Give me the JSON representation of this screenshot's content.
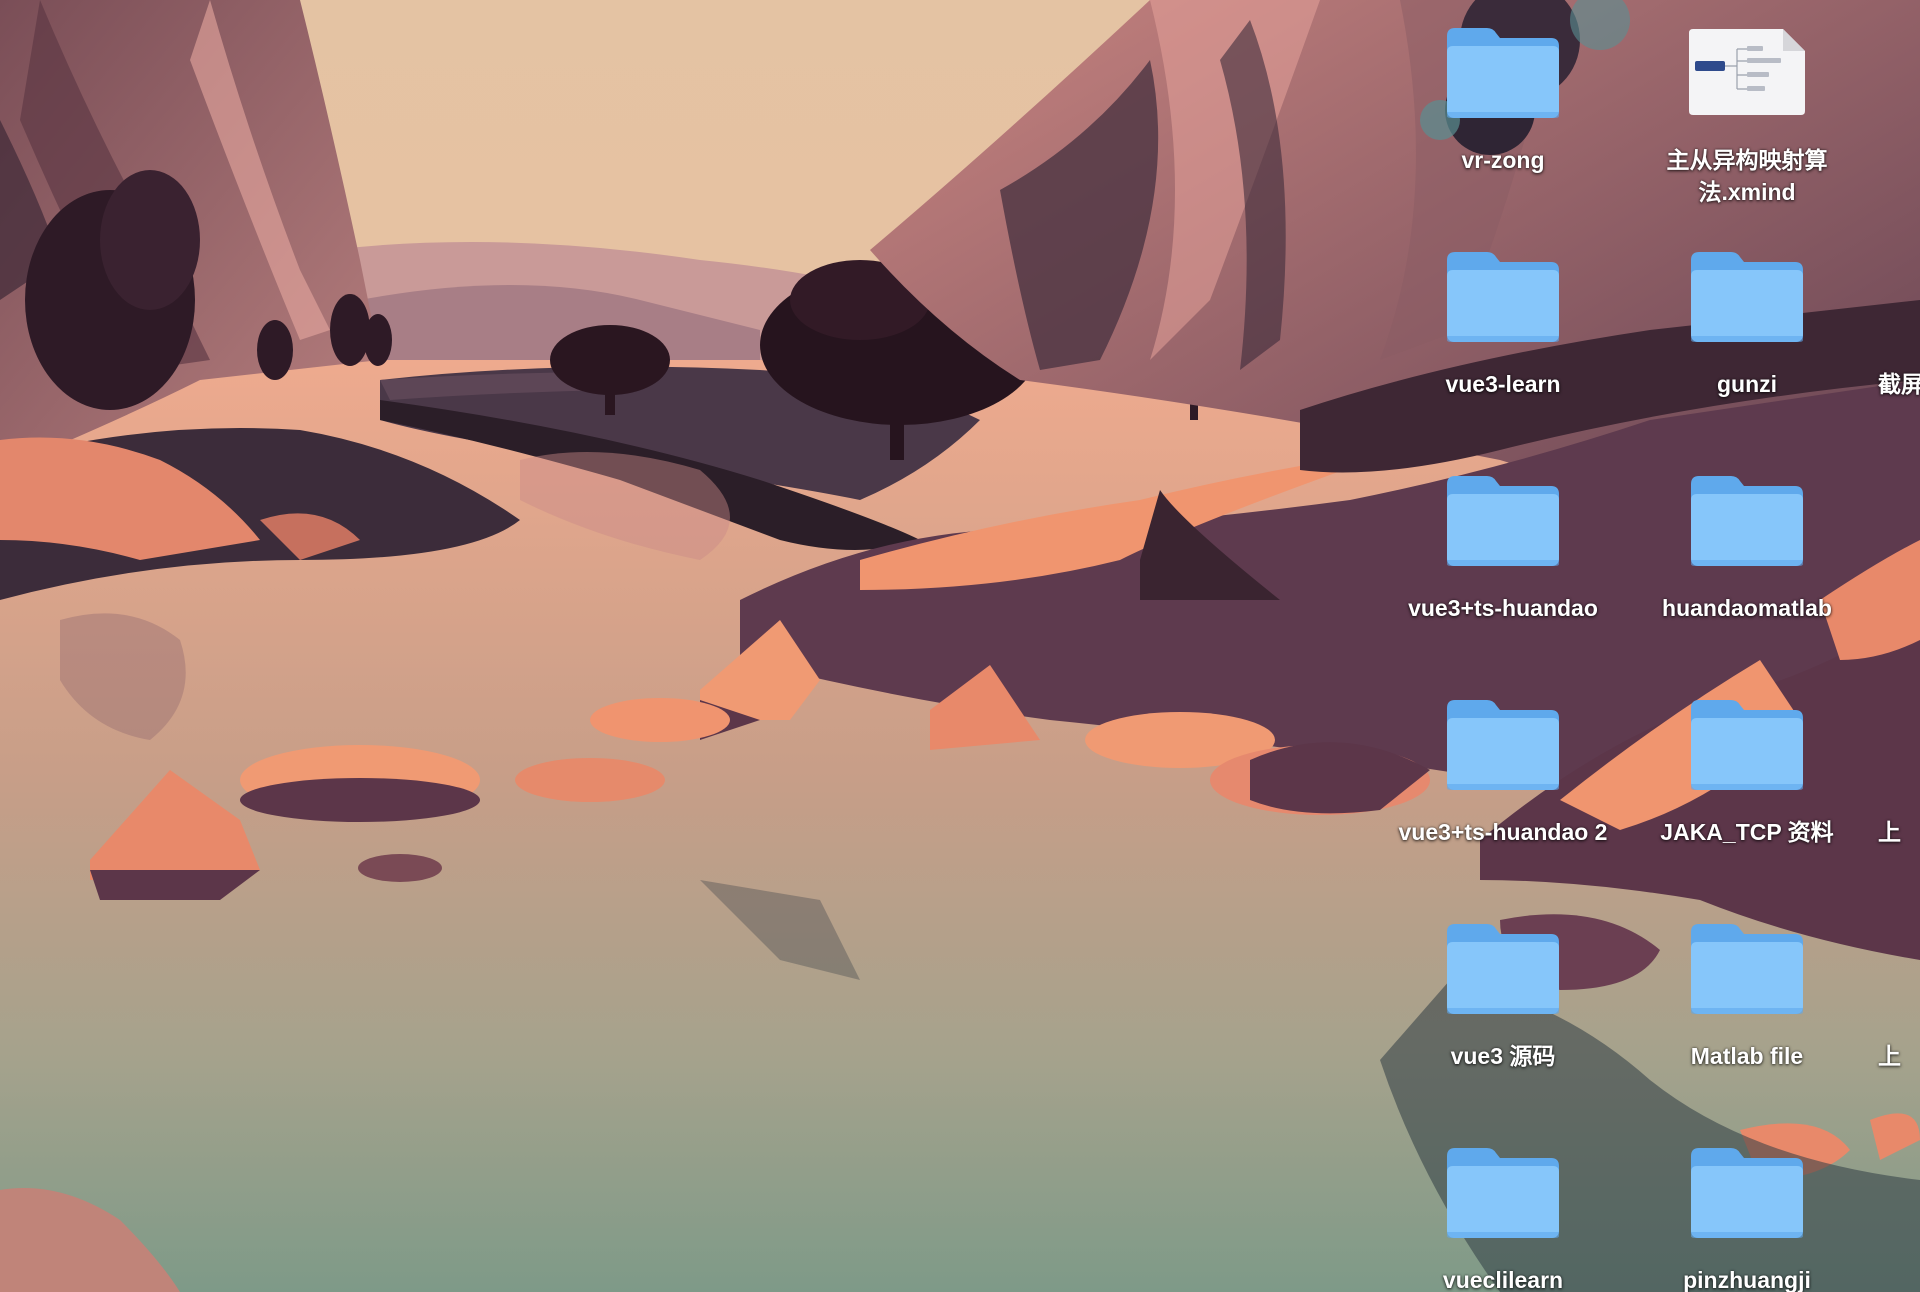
{
  "desktop": {
    "icons": [
      {
        "name": "vr-zong",
        "kind": "folder"
      },
      {
        "name": "主从异构映射算法.xmind",
        "kind": "xmind-file",
        "thumb_title": "主从异构映射算法"
      },
      {
        "name": "vue3-learn",
        "kind": "folder"
      },
      {
        "name": "gunzi",
        "kind": "folder"
      },
      {
        "name": "截屏",
        "kind": "partial"
      },
      {
        "name": "vue3+ts-huandao",
        "kind": "folder"
      },
      {
        "name": "huandaomatlab",
        "kind": "folder"
      },
      {
        "name": "vue3+ts-huandao 2",
        "kind": "folder"
      },
      {
        "name": "JAKA_TCP 资料",
        "kind": "folder"
      },
      {
        "name": "上",
        "kind": "partial"
      },
      {
        "name": "vue3 源码",
        "kind": "folder"
      },
      {
        "name": "Matlab file",
        "kind": "folder"
      },
      {
        "name": "上",
        "kind": "partial"
      },
      {
        "name": "vueclilearn",
        "kind": "folder"
      },
      {
        "name": "pinzhuangji",
        "kind": "folder"
      }
    ]
  },
  "colors": {
    "folder_back": "#5FA9EC",
    "folder_front": "#86C6FA",
    "label_text": "#FFFFFF",
    "sky_top": "#E4C3A3",
    "water_bottom": "#7E9A88"
  }
}
